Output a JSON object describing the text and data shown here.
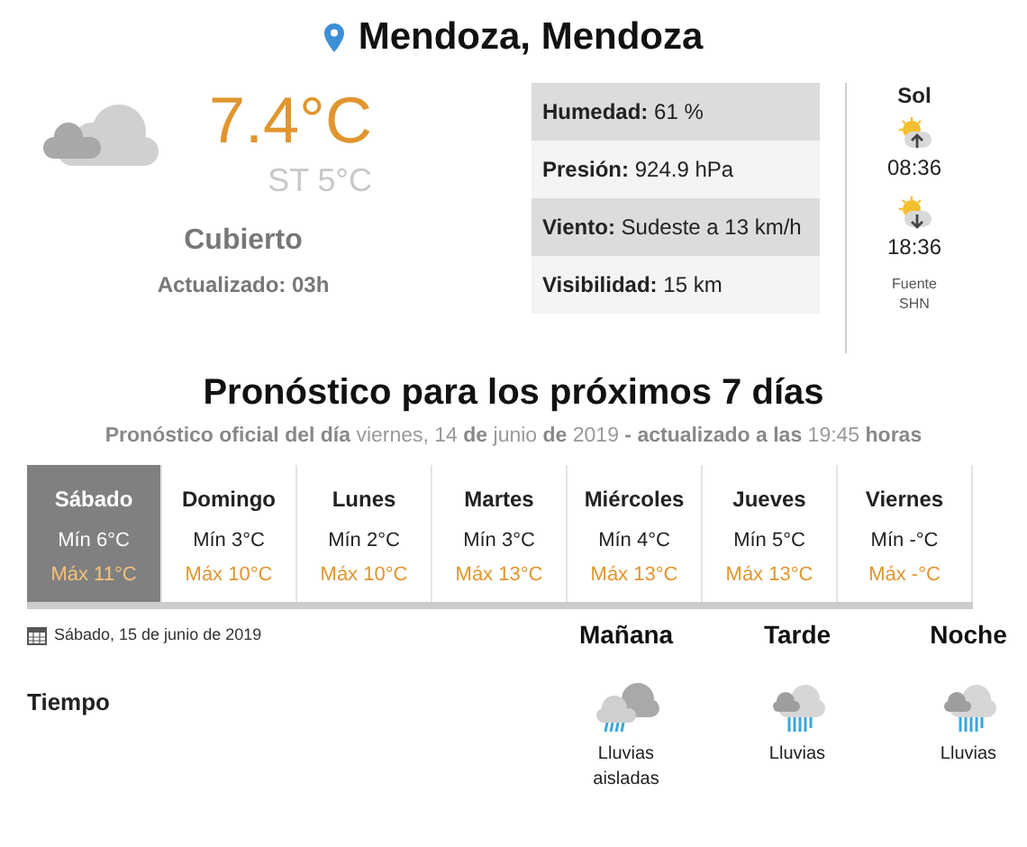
{
  "location": "Mendoza, Mendoza",
  "current": {
    "temperature": "7.4°C",
    "feels_like": "ST 5°C",
    "condition": "Cubierto",
    "updated": "Actualizado: 03h"
  },
  "stats": [
    {
      "label": "Humedad:",
      "value": "61 %"
    },
    {
      "label": "Presión:",
      "value": "924.9 hPa"
    },
    {
      "label": "Viento:",
      "value": "Sudeste a 13 km/h"
    },
    {
      "label": "Visibilidad:",
      "value": "15 km"
    }
  ],
  "sun": {
    "title": "Sol",
    "events": [
      {
        "kind": "sunrise",
        "time": "08:36"
      },
      {
        "kind": "sunset",
        "time": "18:36"
      }
    ],
    "source": [
      "Fuente",
      "SHN"
    ]
  },
  "forecast": {
    "title": "Pronóstico para los próximos 7 días",
    "subtitle": "**Pronóstico oficial del día** viernes, 14 **de** junio **de** 2019 **- actualizado a las** 19:45 **horas**",
    "days": [
      {
        "name": "Sábado",
        "min": "Mín 6°C",
        "max": "Máx 11°C",
        "selected": true
      },
      {
        "name": "Domingo",
        "min": "Mín 3°C",
        "max": "Máx 10°C",
        "selected": false
      },
      {
        "name": "Lunes",
        "min": "Mín 2°C",
        "max": "Máx 10°C",
        "selected": false
      },
      {
        "name": "Martes",
        "min": "Mín 3°C",
        "max": "Máx 13°C",
        "selected": false
      },
      {
        "name": "Miércoles",
        "min": "Mín 4°C",
        "max": "Máx 13°C",
        "selected": false
      },
      {
        "name": "Jueves",
        "min": "Mín 5°C",
        "max": "Máx 13°C",
        "selected": false
      },
      {
        "name": "Viernes",
        "min": "Mín -°C",
        "max": "Máx -°C",
        "selected": false
      }
    ]
  },
  "detail": {
    "date": "Sábado, 15 de junio de 2019",
    "row_label": "Tiempo",
    "periods": [
      {
        "name": "Mañana",
        "kind": "isolated-rain",
        "condition": "Lluvias aisladas"
      },
      {
        "name": "Tarde",
        "kind": "rain",
        "condition": "Lluvias"
      },
      {
        "name": "Noche",
        "kind": "rain",
        "condition": "Lluvias"
      }
    ]
  }
}
